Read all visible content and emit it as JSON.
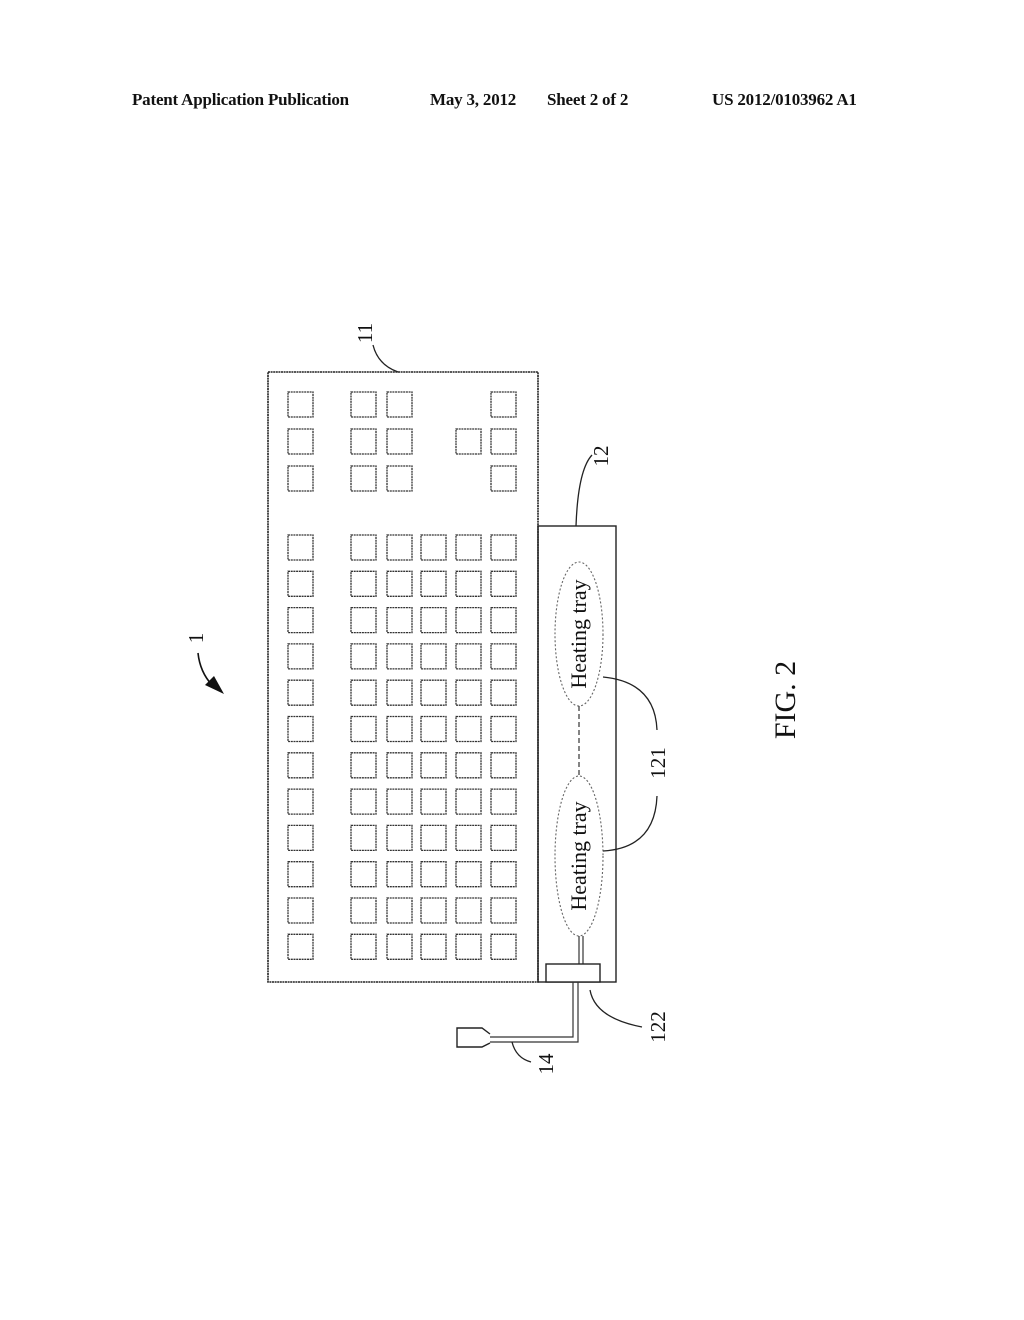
{
  "header": {
    "publication_type": "Patent Application Publication",
    "date": "May 3, 2012",
    "sheet": "Sheet 2 of 2",
    "publication_number": "US 2012/0103962 A1"
  },
  "figure": {
    "caption": "FIG. 2",
    "reference_labels": {
      "device": "1",
      "keyboard": "11",
      "heating_module": "12",
      "heating_trays": "121",
      "connector": "122",
      "cable": "14"
    },
    "heating_trays": [
      {
        "label": "Heating tray"
      },
      {
        "label": "Heating tray"
      }
    ],
    "keyboard": {
      "top_block": {
        "rows": [
          [
            1,
            1,
            1,
            0,
            0,
            1
          ],
          [
            1,
            1,
            1,
            0,
            1,
            1
          ],
          [
            1,
            1,
            1,
            0,
            0,
            1
          ]
        ]
      },
      "main_block": {
        "rows": 12,
        "columns_left": 1,
        "columns_right": 5
      }
    }
  }
}
